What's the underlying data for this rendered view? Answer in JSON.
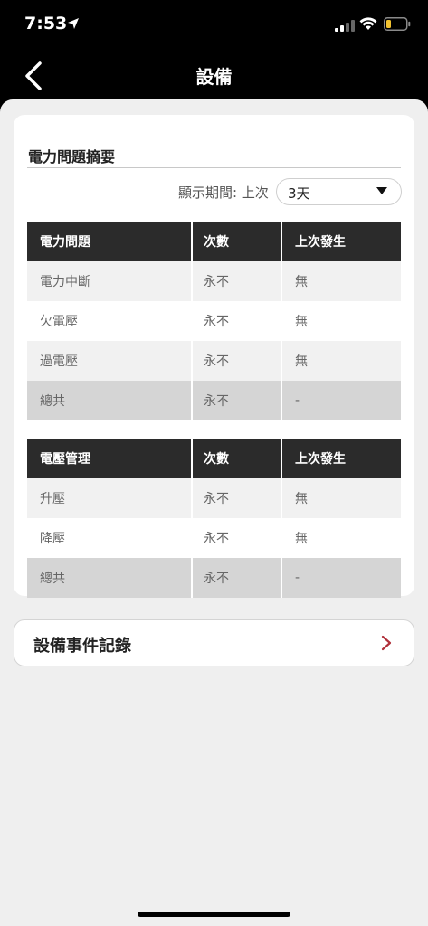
{
  "status_bar": {
    "time": "7:53",
    "icons": [
      "location-arrow-icon",
      "cellular-signal-icon",
      "wifi-icon",
      "battery-low-icon"
    ],
    "battery_color": "#f2c230"
  },
  "nav": {
    "title": "設備",
    "back_icon": "chevron-left-icon"
  },
  "summary": {
    "title": "電力問題摘要",
    "period_label": "顯示期間: 上次",
    "period_value": "3天"
  },
  "power_issues_table": {
    "headers": [
      "電力問題",
      "次數",
      "上次發生"
    ],
    "rows": [
      [
        "電力中斷",
        "永不",
        "無"
      ],
      [
        "欠電壓",
        "永不",
        "無"
      ],
      [
        "過電壓",
        "永不",
        "無"
      ],
      [
        "總共",
        "永不",
        "-"
      ]
    ]
  },
  "voltage_table": {
    "headers": [
      "電壓管理",
      "次數",
      "上次發生"
    ],
    "rows": [
      [
        "升壓",
        "永不",
        "無"
      ],
      [
        "降壓",
        "永不",
        "無"
      ],
      [
        "總共",
        "永不",
        "-"
      ]
    ]
  },
  "event_log": {
    "label": "設備事件記錄",
    "chevron_color": "#b0303a"
  },
  "colors": {
    "header_bg": "#000000",
    "table_header_bg": "#2b2b2b",
    "sheet_bg": "#efefef"
  }
}
